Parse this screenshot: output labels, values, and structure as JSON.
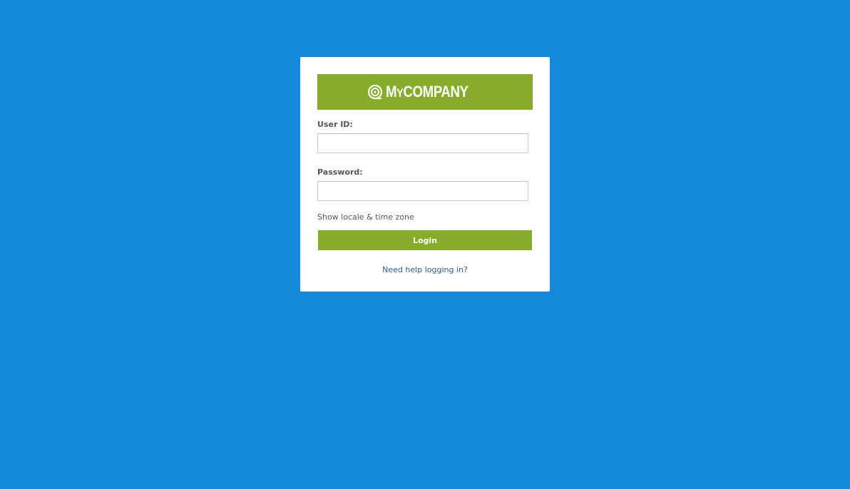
{
  "colors": {
    "background": "#1488db",
    "brand_green": "#86ad29",
    "card": "#ffffff",
    "link": "#2a5d8f"
  },
  "logo": {
    "icon": "spiral-logo-icon",
    "text_lead": "M",
    "text_small": "Y",
    "text_rest": "COMPANY"
  },
  "form": {
    "user_id_label": "User ID:",
    "user_id_value": "",
    "password_label": "Password:",
    "password_value": "",
    "locale_link": "Show locale & time zone",
    "login_label": "Login",
    "help_link": "Need help logging in?"
  }
}
